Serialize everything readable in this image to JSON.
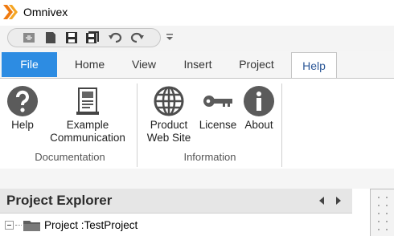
{
  "app": {
    "title": "Omnivex"
  },
  "quick_access": {
    "buttons": [
      "new-icon",
      "open-icon",
      "save-icon",
      "save-all-icon",
      "undo-icon",
      "redo-icon",
      "customize-icon"
    ]
  },
  "ribbon": {
    "tabs": [
      "File",
      "Home",
      "View",
      "Insert",
      "Project",
      "Help"
    ],
    "active_tab": "Help",
    "groups": [
      {
        "label": "Documentation",
        "buttons": [
          {
            "label": "Help",
            "icon": "question-icon"
          },
          {
            "label": "Example\nCommunication",
            "icon": "document-icon"
          }
        ]
      },
      {
        "label": "Information",
        "buttons": [
          {
            "label": "Product\nWeb Site",
            "icon": "globe-icon"
          },
          {
            "label": "License",
            "icon": "key-icon"
          },
          {
            "label": "About",
            "icon": "info-icon"
          }
        ]
      }
    ]
  },
  "explorer": {
    "title": "Project Explorer",
    "tree": [
      {
        "label": "Project :TestProject",
        "expanded": true
      }
    ]
  },
  "colors": {
    "file_tab": "#2d8ce2",
    "accent": "#f07b10"
  }
}
